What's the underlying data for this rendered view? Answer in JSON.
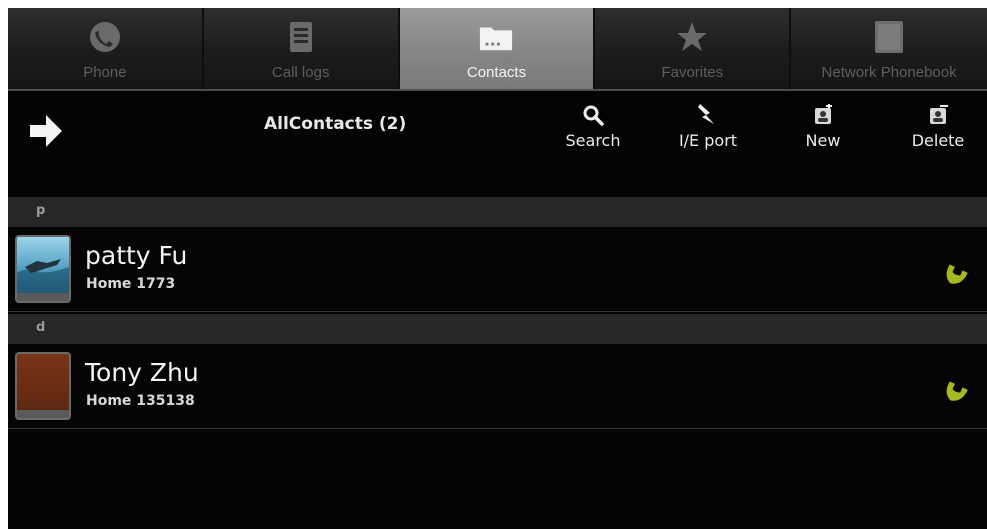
{
  "tabs": [
    {
      "label": "Phone",
      "icon": "phone-icon",
      "active": false
    },
    {
      "label": "Call logs",
      "icon": "call-logs-icon",
      "active": false
    },
    {
      "label": "Contacts",
      "icon": "contacts-icon",
      "active": true
    },
    {
      "label": "Favorites",
      "icon": "star-icon",
      "active": false
    },
    {
      "label": "Network Phonebook",
      "icon": "network-phonebook-icon",
      "active": false
    }
  ],
  "toolbar": {
    "title": "AllContacts (2)",
    "search_label": "Search",
    "ie_port_label": "I/E port",
    "new_label": "New",
    "delete_label": "Delete"
  },
  "sections": [
    {
      "letter": "p",
      "contacts": [
        {
          "name": "patty Fu",
          "detail": "Home 1773",
          "avatar": "photo"
        }
      ]
    },
    {
      "letter": "d",
      "contacts": [
        {
          "name": "Tony Zhu",
          "detail": "Home 135138",
          "avatar": "plain"
        }
      ]
    }
  ],
  "colors": {
    "background": "#030303",
    "active_tab": "#8a8a8a",
    "call_icon": "#a8b820",
    "section_header": "#272727"
  }
}
